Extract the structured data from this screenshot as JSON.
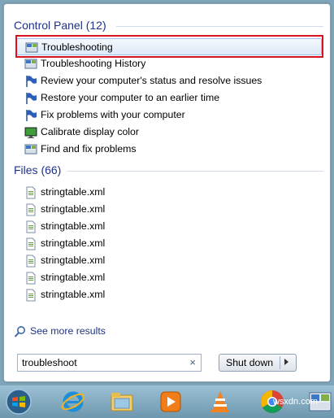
{
  "control_panel": {
    "header": "Control Panel (12)",
    "items": [
      {
        "label": "Troubleshooting",
        "icon": "control-panel-icon",
        "selected": true
      },
      {
        "label": "Troubleshooting History",
        "icon": "control-panel-icon"
      },
      {
        "label": "Review your computer's status and resolve issues",
        "icon": "flag-icon"
      },
      {
        "label": "Restore your computer to an earlier time",
        "icon": "flag-icon"
      },
      {
        "label": "Fix problems with your computer",
        "icon": "flag-icon"
      },
      {
        "label": "Calibrate display color",
        "icon": "monitor-icon"
      },
      {
        "label": "Find and fix problems",
        "icon": "control-panel-icon"
      }
    ]
  },
  "files": {
    "header": "Files (66)",
    "items": [
      {
        "label": "stringtable.xml"
      },
      {
        "label": "stringtable.xml"
      },
      {
        "label": "stringtable.xml"
      },
      {
        "label": "stringtable.xml"
      },
      {
        "label": "stringtable.xml"
      },
      {
        "label": "stringtable.xml"
      },
      {
        "label": "stringtable.xml"
      }
    ]
  },
  "see_more": {
    "label": "See more results"
  },
  "search": {
    "value": "troubleshoot",
    "clear_glyph": "×"
  },
  "shutdown": {
    "label": "Shut down"
  },
  "taskbar": {
    "items": [
      {
        "name": "start-orb-icon"
      },
      {
        "name": "internet-explorer-icon"
      },
      {
        "name": "file-explorer-icon"
      },
      {
        "name": "media-player-icon"
      },
      {
        "name": "vlc-icon"
      },
      {
        "name": "chrome-icon"
      },
      {
        "name": "control-panel-taskbar-icon"
      }
    ]
  },
  "watermark": "wsxdn.com",
  "colors": {
    "header_text": "#1e3287",
    "highlight_border": "#d6131f",
    "selection_fill": "#dceaf9"
  }
}
